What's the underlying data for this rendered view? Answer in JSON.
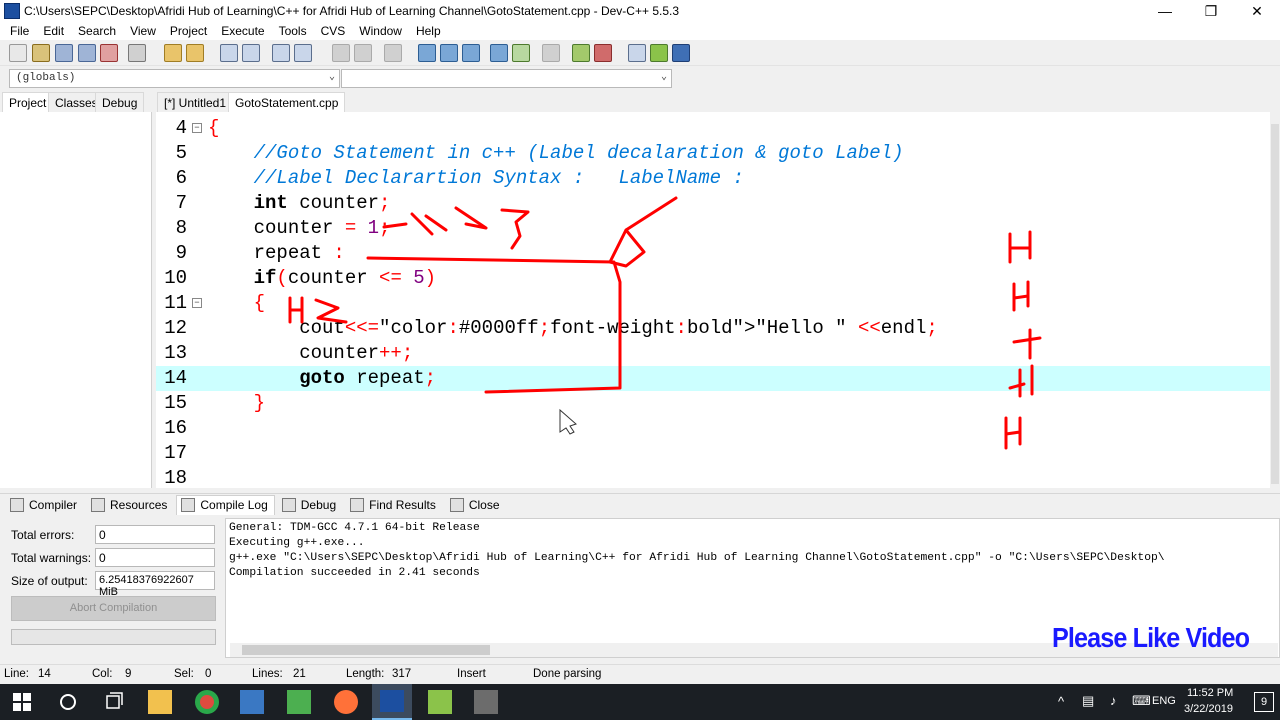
{
  "window": {
    "title": "C:\\Users\\SEPC\\Desktop\\Afridi Hub of Learning\\C++ for Afridi Hub of Learning Channel\\GotoStatement.cpp - Dev-C++ 5.5.3",
    "minimize": "—",
    "maximize": "❐",
    "close": "✕"
  },
  "menu": [
    "File",
    "Edit",
    "Search",
    "View",
    "Project",
    "Execute",
    "Tools",
    "CVS",
    "Window",
    "Help"
  ],
  "combos": {
    "scope": "(globals)",
    "member": ""
  },
  "left_tabs": [
    "Project",
    "Classes",
    "Debug"
  ],
  "editor_tabs": [
    "[*] Untitled1",
    "GotoStatement.cpp"
  ],
  "editor": {
    "current_line": "14",
    "lines": [
      {
        "n": "4",
        "fold": "−",
        "code": "{"
      },
      {
        "n": "5",
        "code": "    //Goto Statement in c++ (Label decalaration & goto Label)"
      },
      {
        "n": "6",
        "code": "    //Label Declarartion Syntax :   LabelName :"
      },
      {
        "n": "7",
        "code": "    int counter;"
      },
      {
        "n": "8",
        "code": "    counter = 1;"
      },
      {
        "n": "9",
        "code": "    repeat :"
      },
      {
        "n": "10",
        "code": "    if(counter <= 5)"
      },
      {
        "n": "11",
        "fold": "−",
        "code": "    {"
      },
      {
        "n": "12",
        "code": "        cout<<\"Hello \" <<endl;"
      },
      {
        "n": "13",
        "code": "        counter++;"
      },
      {
        "n": "14",
        "code": "        goto repeat;"
      },
      {
        "n": "15",
        "code": "    }"
      },
      {
        "n": "16",
        "code": ""
      },
      {
        "n": "17",
        "code": ""
      },
      {
        "n": "18",
        "code": ""
      }
    ]
  },
  "bottom_tabs": [
    "Compiler",
    "Resources",
    "Compile Log",
    "Debug",
    "Find Results",
    "Close"
  ],
  "stats": {
    "errors_label": "Total errors:",
    "errors": "0",
    "warnings_label": "Total warnings:",
    "warnings": "0",
    "size_label": "Size of output:",
    "size": "6.25418376922607 MiB",
    "abort": "Abort Compilation"
  },
  "log": [
    "General: TDM-GCC 4.7.1 64-bit Release",
    "Executing g++.exe...",
    "g++.exe \"C:\\Users\\SEPC\\Desktop\\Afridi Hub of Learning\\C++ for Afridi Hub of Learning Channel\\GotoStatement.cpp\" -o \"C:\\Users\\SEPC\\Desktop\\",
    "Compilation succeeded in 2.41 seconds"
  ],
  "overlay_text": "Please Like Video",
  "status": {
    "line_label": "Line:",
    "line": "14",
    "col_label": "Col:",
    "col": "9",
    "sel_label": "Sel:",
    "sel": "0",
    "lines_label": "Lines:",
    "lines": "21",
    "length_label": "Length:",
    "length": "317",
    "mode": "Insert",
    "parse": "Done parsing"
  },
  "taskbar": {
    "lang": "ENG",
    "time": "11:52 PM",
    "date": "3/22/2019",
    "notif": "9"
  },
  "colors": {
    "current_line": "#ccffff",
    "comment": "#0078d7",
    "symbol": "#ff0000",
    "string": "#0000ff",
    "number": "#800080",
    "annotation": "#ff0000",
    "overlay": "#1a1aff"
  }
}
